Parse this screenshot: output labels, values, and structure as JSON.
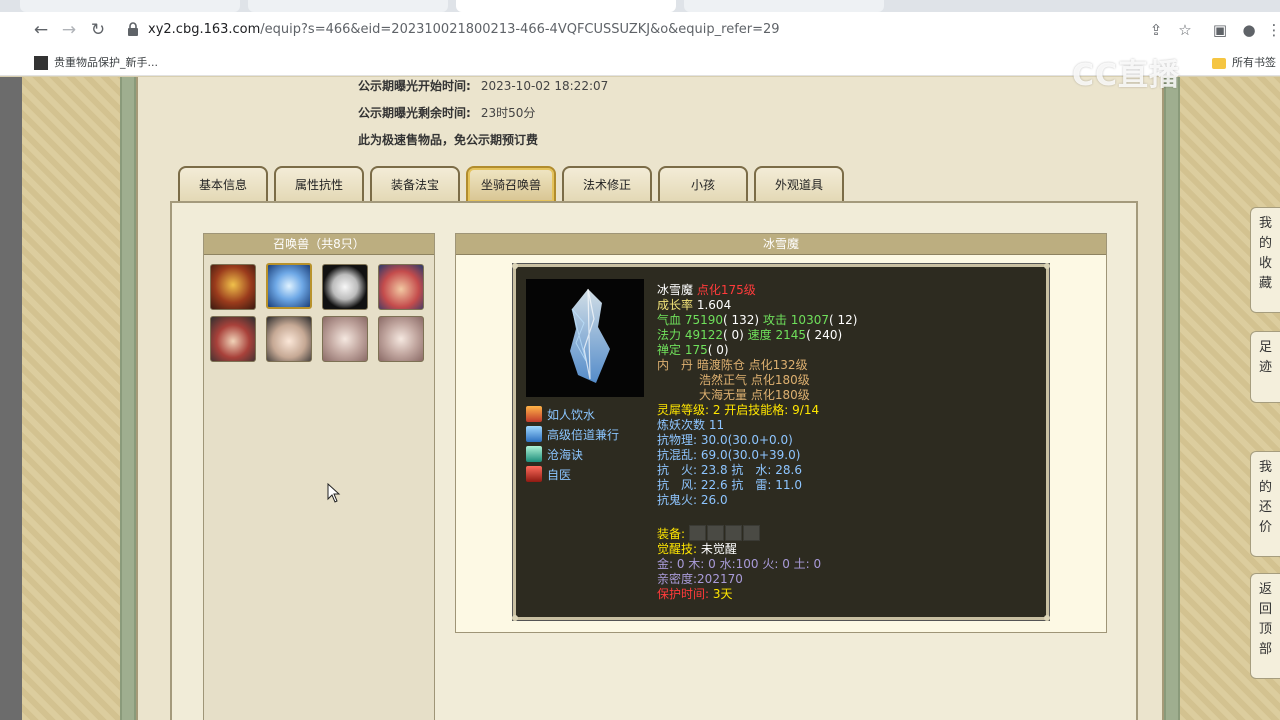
{
  "browser": {
    "url_host": "xy2.cbg.163.com",
    "url_path": "/equip?s=466&eid=202310021800213-466-4VQFCUSSUZKJ&o&equip_refer=29",
    "bookmark_left": "贵重物品保护_新手...",
    "bookmark_right": "所有书签",
    "watermark": "CC直播"
  },
  "notices": [
    {
      "key": "公示期曝光开始时间:",
      "value": "2023-10-02 18:22:07"
    },
    {
      "key": "公示期曝光剩余时间:",
      "value": "23时50分"
    },
    {
      "key": "此为极速售物品，免公示期预订费",
      "value": ""
    }
  ],
  "tabs": [
    "基本信息",
    "属性抗性",
    "装备法宝",
    "坐骑召唤兽",
    "法术修正",
    "小孩",
    "外观道具"
  ],
  "active_tab": "坐骑召唤兽",
  "pet_list": {
    "title": "召唤兽（共8只）"
  },
  "pet": {
    "title": "冰雪魔",
    "name": "冰雪魔",
    "level": "点化175级",
    "growth_label": "成长率",
    "growth": "1.604",
    "hp_label": "气血",
    "hp": "75190",
    "hp_bonus": "( 132)",
    "atk_label": "攻击",
    "atk": "10307",
    "atk_bonus": "( 12)",
    "mp_label": "法力",
    "mp": "49122",
    "mp_bonus": "( 0)",
    "spd_label": "速度",
    "spd": "2145",
    "spd_bonus": "( 240)",
    "def_label": "禅定",
    "def": "175",
    "def_bonus": "( 0)",
    "inner_label": "内　丹",
    "inner": [
      "暗渡陈仓 点化132级",
      "浩然正气 点化180级",
      "大海无量 点化180级"
    ],
    "spirit": "灵犀等级:  2  开启技能格:  9/14",
    "refine": "炼妖次数 11",
    "resist_phys": "抗物理: 30.0(30.0+0.0)",
    "resist_chaos": "抗混乱: 69.0(30.0+39.0)",
    "resist_line1": "抗　火: 23.8 抗　水: 28.6",
    "resist_line2": "抗　风: 22.6 抗　雷: 11.0",
    "resist_ghost": "抗鬼火: 26.0",
    "equip_label": "装备:",
    "awaken_label": "觉醒技:",
    "awaken": "未觉醒",
    "elements": "金: 0 木: 0 水:100 火: 0 土: 0",
    "intimacy": "亲密度:202170",
    "protect_label": "保护时间:",
    "protect": "3天",
    "skills": [
      "如人饮水",
      "高级倍道兼行",
      "沧海诀",
      "自医"
    ]
  },
  "side_buttons": [
    "我的收藏",
    "足迹",
    "我的还价",
    "返回顶部"
  ]
}
